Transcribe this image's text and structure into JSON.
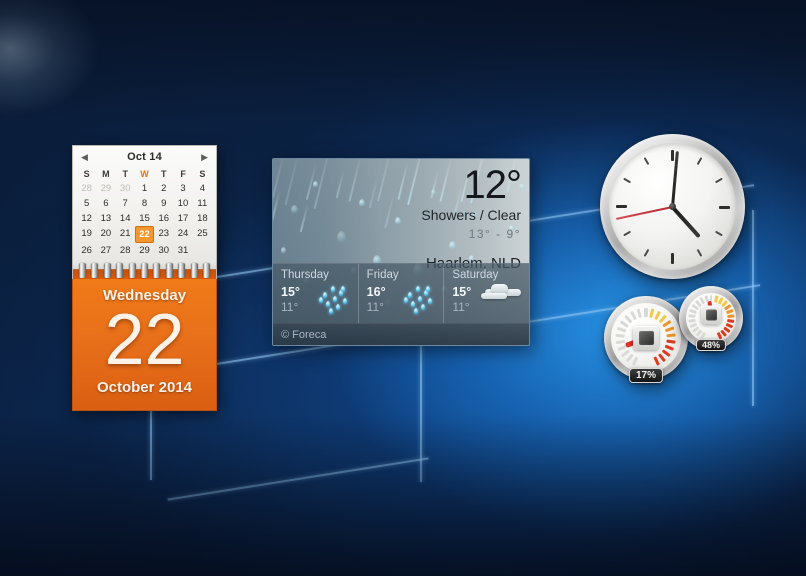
{
  "desktop": {
    "name": "Windows desktop with sidebar gadgets",
    "wallpaper_logo": "windows-logo-watermark",
    "colors": {
      "bg_dark_navy": "#0a1b35",
      "bg_bright_blue": "#1f8ae0",
      "logo_line": "#96cdfa",
      "accent_orange": "#e8701a",
      "selection_orange": "#f59831",
      "second_hand_red": "#c93540"
    }
  },
  "calendar": {
    "prev_label": "◀",
    "next_label": "▶",
    "title": "Oct 14",
    "dow": [
      "S",
      "M",
      "T",
      "W",
      "T",
      "F",
      "S"
    ],
    "today_dow_index": 3,
    "weeks": [
      [
        {
          "d": "28",
          "out": true
        },
        {
          "d": "29",
          "out": true
        },
        {
          "d": "30",
          "out": true
        },
        {
          "d": "1"
        },
        {
          "d": "2"
        },
        {
          "d": "3"
        },
        {
          "d": "4"
        }
      ],
      [
        {
          "d": "5"
        },
        {
          "d": "6"
        },
        {
          "d": "7"
        },
        {
          "d": "8"
        },
        {
          "d": "9"
        },
        {
          "d": "10"
        },
        {
          "d": "11"
        }
      ],
      [
        {
          "d": "12"
        },
        {
          "d": "13"
        },
        {
          "d": "14"
        },
        {
          "d": "15"
        },
        {
          "d": "16"
        },
        {
          "d": "17"
        },
        {
          "d": "18"
        }
      ],
      [
        {
          "d": "19"
        },
        {
          "d": "20"
        },
        {
          "d": "21"
        },
        {
          "d": "22",
          "sel": true
        },
        {
          "d": "23"
        },
        {
          "d": "24"
        },
        {
          "d": "25"
        }
      ],
      [
        {
          "d": "26"
        },
        {
          "d": "27"
        },
        {
          "d": "28"
        },
        {
          "d": "29"
        },
        {
          "d": "30"
        },
        {
          "d": "31"
        },
        {
          "d": ""
        }
      ]
    ],
    "weekday": "Wednesday",
    "day_number": "22",
    "month_year": "October 2014"
  },
  "weather": {
    "temperature": "12°",
    "condition": "Showers / Clear",
    "range": "13°  -  9°",
    "location": "Haarlem, NLD",
    "credit": "© Foreca",
    "forecast": [
      {
        "day": "Thursday",
        "high": "15°",
        "low": "11°",
        "icon": "rain-icon"
      },
      {
        "day": "Friday",
        "high": "16°",
        "low": "11°",
        "icon": "rain-icon"
      },
      {
        "day": "Saturday",
        "high": "15°",
        "low": "11°",
        "icon": "cloud-icon"
      }
    ]
  },
  "clock": {
    "name": "analog-clock",
    "hour_deg": 138,
    "minute_deg": 5,
    "second_deg": 258
  },
  "meters": [
    {
      "name": "cpu-meter",
      "icon": "cpu-chip-icon",
      "readout": "17%",
      "needle_deg": 250
    },
    {
      "name": "memory-meter",
      "icon": "memory-chip-icon",
      "readout": "48%",
      "needle_deg": 355
    }
  ]
}
